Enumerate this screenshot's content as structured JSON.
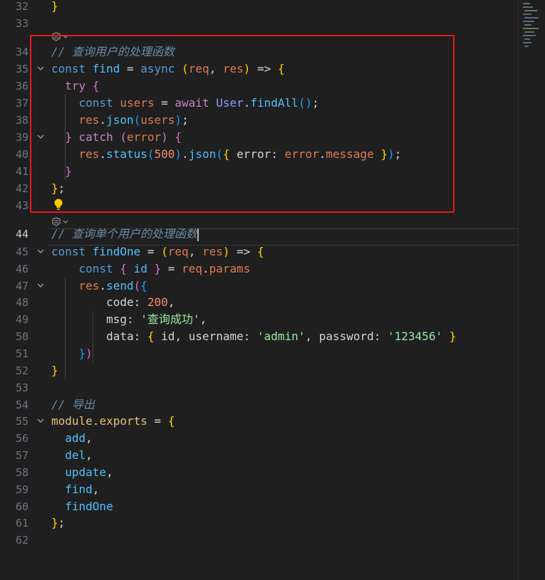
{
  "editor": {
    "lines": [
      {
        "n": "32",
        "t": [
          [
            "b1",
            "}"
          ]
        ]
      },
      {
        "n": "33",
        "t": []
      },
      {
        "n": "34",
        "t": [
          [
            "cmt",
            "// 查询用户的处理函数"
          ]
        ]
      },
      {
        "n": "35",
        "t": [
          [
            "kw",
            "const "
          ],
          [
            "fn",
            "find"
          ],
          [
            "op",
            " = "
          ],
          [
            "kw",
            "async "
          ],
          [
            "b1",
            "("
          ],
          [
            "prm",
            "req"
          ],
          [
            "op",
            ", "
          ],
          [
            "prm",
            "res"
          ],
          [
            "b1",
            ")"
          ],
          [
            "op",
            " => "
          ],
          [
            "b1",
            "{"
          ]
        ]
      },
      {
        "n": "36",
        "t": [
          [
            "ctl",
            "  try "
          ],
          [
            "b2",
            "{"
          ]
        ]
      },
      {
        "n": "37",
        "t": [
          [
            "kw",
            "    const "
          ],
          [
            "prm",
            "users"
          ],
          [
            "op",
            " = "
          ],
          [
            "ctl",
            "await "
          ],
          [
            "cls",
            "User"
          ],
          [
            "op",
            "."
          ],
          [
            "fn",
            "findAll"
          ],
          [
            "b3",
            "()"
          ],
          [
            "op",
            ";"
          ]
        ]
      },
      {
        "n": "38",
        "t": [
          [
            "prm",
            "    res"
          ],
          [
            "op",
            "."
          ],
          [
            "fn",
            "json"
          ],
          [
            "b3",
            "("
          ],
          [
            "prm",
            "users"
          ],
          [
            "b3",
            ")"
          ],
          [
            "op",
            ";"
          ]
        ]
      },
      {
        "n": "39",
        "t": [
          [
            "b2",
            "  }"
          ],
          [
            "ctl",
            " catch "
          ],
          [
            "b2",
            "("
          ],
          [
            "prm",
            "error"
          ],
          [
            "b2",
            ")"
          ],
          [
            "b2",
            " {"
          ]
        ]
      },
      {
        "n": "40",
        "t": [
          [
            "prm",
            "    res"
          ],
          [
            "op",
            "."
          ],
          [
            "fn",
            "status"
          ],
          [
            "b3",
            "("
          ],
          [
            "num",
            "500"
          ],
          [
            "b3",
            ")"
          ],
          [
            "op",
            "."
          ],
          [
            "fn",
            "json"
          ],
          [
            "b3",
            "("
          ],
          [
            "b1",
            "{ "
          ],
          [
            "txt",
            "error"
          ],
          [
            "op",
            ": "
          ],
          [
            "prm",
            "error"
          ],
          [
            "op",
            "."
          ],
          [
            "prm",
            "message"
          ],
          [
            "b1",
            " }"
          ],
          [
            "b3",
            ")"
          ],
          [
            "op",
            ";"
          ]
        ]
      },
      {
        "n": "41",
        "t": [
          [
            "b2",
            "  }"
          ]
        ]
      },
      {
        "n": "42",
        "t": [
          [
            "b1",
            "}"
          ],
          [
            "op",
            ";"
          ]
        ]
      },
      {
        "n": "43",
        "t": []
      },
      {
        "n": "44",
        "t": [
          [
            "cmt",
            "// 查询单个用户的处理函数"
          ]
        ]
      },
      {
        "n": "45",
        "t": [
          [
            "kw",
            "const "
          ],
          [
            "fn",
            "findOne"
          ],
          [
            "op",
            " = "
          ],
          [
            "b1",
            "("
          ],
          [
            "prm",
            "req"
          ],
          [
            "op",
            ", "
          ],
          [
            "prm",
            "res"
          ],
          [
            "b1",
            ")"
          ],
          [
            "op",
            " => "
          ],
          [
            "b1",
            "{"
          ]
        ]
      },
      {
        "n": "46",
        "t": [
          [
            "kw",
            "    const "
          ],
          [
            "b2",
            "{ "
          ],
          [
            "blu",
            "id"
          ],
          [
            "b2",
            " }"
          ],
          [
            "op",
            " = "
          ],
          [
            "prm",
            "req"
          ],
          [
            "op",
            "."
          ],
          [
            "prm",
            "params"
          ]
        ]
      },
      {
        "n": "47",
        "t": [
          [
            "prm",
            "    res"
          ],
          [
            "op",
            "."
          ],
          [
            "fn",
            "send"
          ],
          [
            "b2",
            "("
          ],
          [
            "b3",
            "{"
          ]
        ]
      },
      {
        "n": "48",
        "t": [
          [
            "txt",
            "        code"
          ],
          [
            "op",
            ": "
          ],
          [
            "num",
            "200"
          ],
          [
            "op",
            ","
          ]
        ]
      },
      {
        "n": "49",
        "t": [
          [
            "txt",
            "        msg"
          ],
          [
            "op",
            ": "
          ],
          [
            "str",
            "'查询成功'"
          ],
          [
            "op",
            ","
          ]
        ]
      },
      {
        "n": "50",
        "t": [
          [
            "txt",
            "        data"
          ],
          [
            "op",
            ": "
          ],
          [
            "b1",
            "{ "
          ],
          [
            "txt",
            "id"
          ],
          [
            "op",
            ", "
          ],
          [
            "txt",
            "username"
          ],
          [
            "op",
            ": "
          ],
          [
            "str",
            "'admin'"
          ],
          [
            "op",
            ", "
          ],
          [
            "txt",
            "password"
          ],
          [
            "op",
            ": "
          ],
          [
            "str",
            "'123456'"
          ],
          [
            "b1",
            " }"
          ]
        ]
      },
      {
        "n": "51",
        "t": [
          [
            "b3",
            "    }"
          ],
          [
            "b2",
            ")"
          ]
        ]
      },
      {
        "n": "52",
        "t": [
          [
            "b1",
            "}"
          ]
        ]
      },
      {
        "n": "53",
        "t": []
      },
      {
        "n": "54",
        "t": [
          [
            "cmt",
            "// 导出"
          ]
        ]
      },
      {
        "n": "55",
        "t": [
          [
            "yel",
            "module"
          ],
          [
            "op",
            "."
          ],
          [
            "yel",
            "exports"
          ],
          [
            "op",
            " = "
          ],
          [
            "b1",
            "{"
          ]
        ]
      },
      {
        "n": "56",
        "t": [
          [
            "blu",
            "  add"
          ],
          [
            "op",
            ","
          ]
        ]
      },
      {
        "n": "57",
        "t": [
          [
            "blu",
            "  del"
          ],
          [
            "op",
            ","
          ]
        ]
      },
      {
        "n": "58",
        "t": [
          [
            "blu",
            "  update"
          ],
          [
            "op",
            ","
          ]
        ]
      },
      {
        "n": "59",
        "t": [
          [
            "blu",
            "  find"
          ],
          [
            "op",
            ","
          ]
        ]
      },
      {
        "n": "60",
        "t": [
          [
            "blu",
            "  findOne"
          ]
        ]
      },
      {
        "n": "61",
        "t": [
          [
            "b1",
            "}"
          ],
          [
            "op",
            ";"
          ]
        ]
      },
      {
        "n": "62",
        "t": []
      }
    ],
    "active_line": "44",
    "highlighted_range": [
      "34",
      "43"
    ]
  },
  "colors": {
    "background": "#1f1f1f",
    "highlight_border": "#e8191e"
  }
}
